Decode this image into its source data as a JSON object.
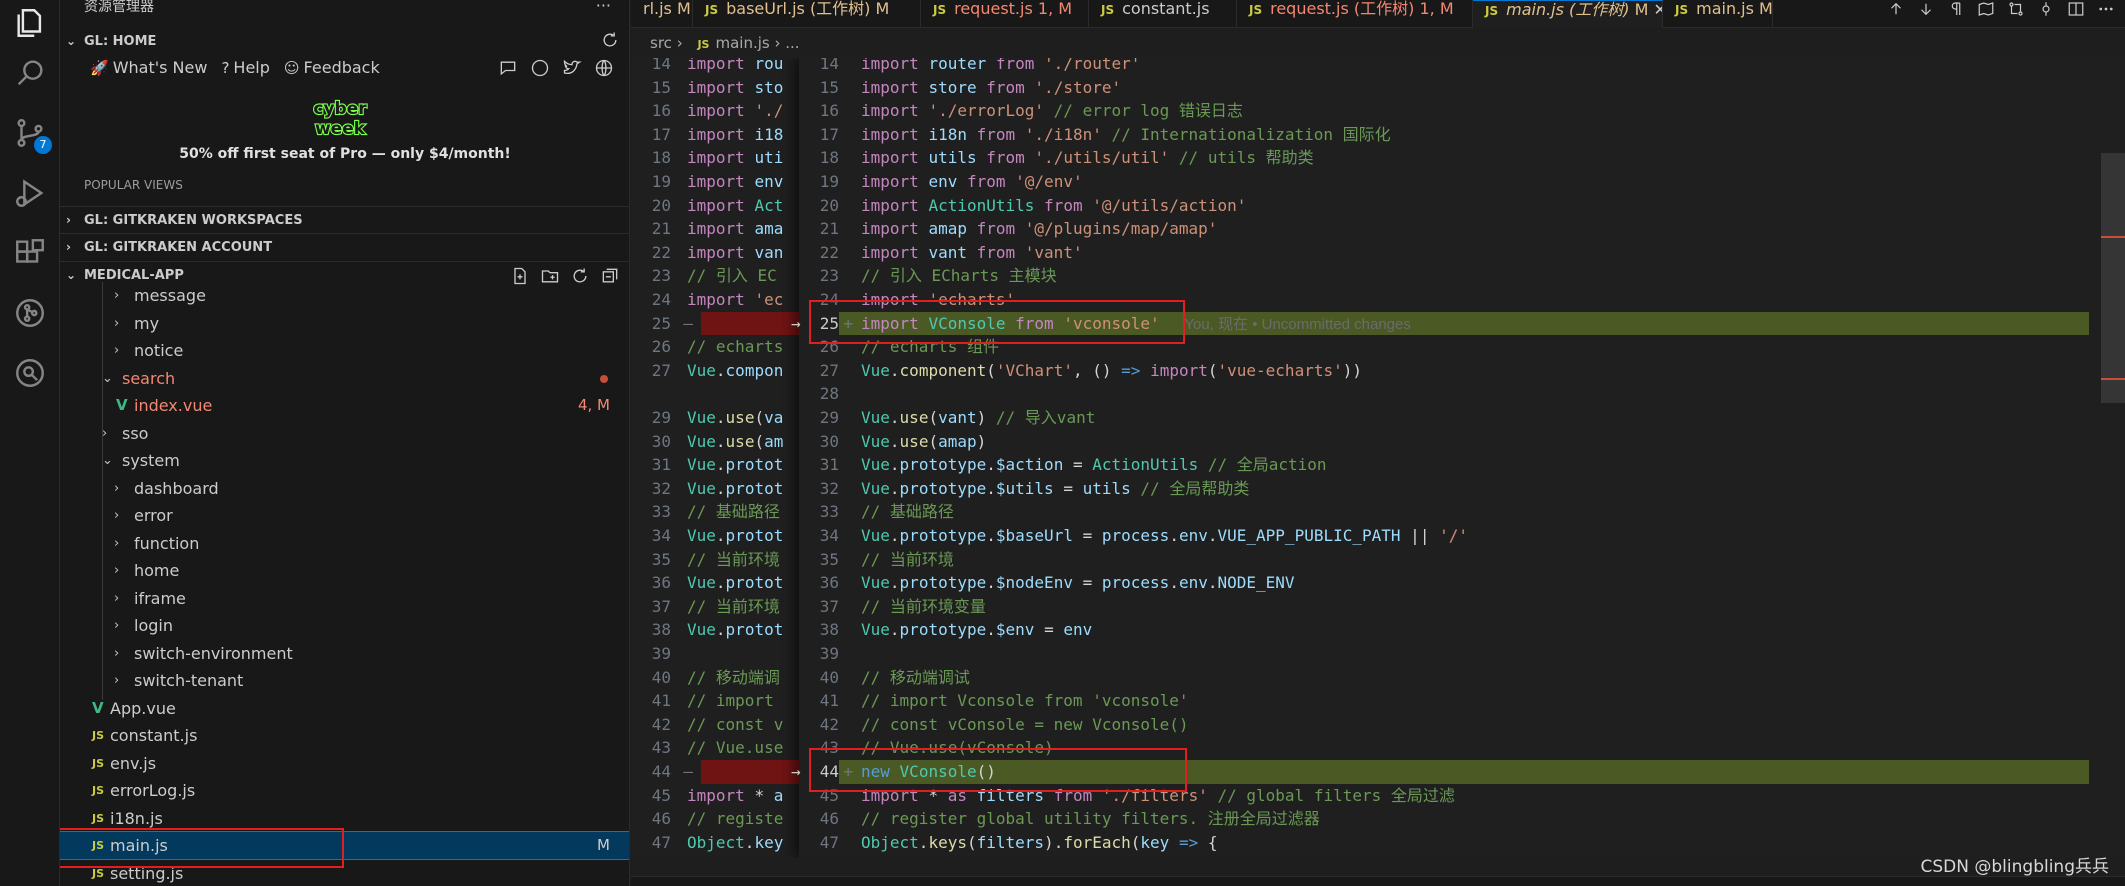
{
  "sidebar": {
    "title": "资源管理器",
    "gl_home": {
      "header": "GL: HOME",
      "links": [
        "What's New",
        "Help",
        "Feedback"
      ],
      "promo_logo_line1": "cyber",
      "promo_logo_line2": "week",
      "promo_text": "50% off first seat of Pro — only $4/month!",
      "popular": "POPULAR VIEWS"
    },
    "sections": {
      "workspaces": "GL: GITKRAKEN WORKSPACES",
      "account": "GL: GITKRAKEN ACCOUNT",
      "project": "MEDICAL-APP"
    },
    "tree": [
      {
        "label": "message",
        "type": "folder",
        "level": 2
      },
      {
        "label": "my",
        "type": "folder",
        "level": 2
      },
      {
        "label": "notice",
        "type": "folder",
        "level": 2
      },
      {
        "label": "search",
        "type": "folder-open",
        "level": 1,
        "status": "modified"
      },
      {
        "label": "index.vue",
        "type": "vue",
        "level": 2,
        "badge": "4, M"
      },
      {
        "label": "sso",
        "type": "folder",
        "level": 1
      },
      {
        "label": "system",
        "type": "folder-open",
        "level": 1
      },
      {
        "label": "dashboard",
        "type": "folder",
        "level": 2
      },
      {
        "label": "error",
        "type": "folder",
        "level": 2
      },
      {
        "label": "function",
        "type": "folder",
        "level": 2
      },
      {
        "label": "home",
        "type": "folder",
        "level": 2
      },
      {
        "label": "iframe",
        "type": "folder",
        "level": 2
      },
      {
        "label": "login",
        "type": "folder",
        "level": 2
      },
      {
        "label": "switch-environment",
        "type": "folder",
        "level": 2
      },
      {
        "label": "switch-tenant",
        "type": "folder",
        "level": 2
      },
      {
        "label": "App.vue",
        "type": "vue",
        "level": 0
      },
      {
        "label": "constant.js",
        "type": "js",
        "level": 0
      },
      {
        "label": "env.js",
        "type": "js",
        "level": 0
      },
      {
        "label": "errorLog.js",
        "type": "js",
        "level": 0
      },
      {
        "label": "i18n.js",
        "type": "js",
        "level": 0
      },
      {
        "label": "main.js",
        "type": "js",
        "level": 0,
        "badge": "M",
        "selected": true
      },
      {
        "label": "setting.js",
        "type": "js",
        "level": 0
      }
    ]
  },
  "badges": {
    "source_control": "7"
  },
  "tabs": [
    {
      "label": "rl.js",
      "suffix": "M",
      "color": "#e2c08d"
    },
    {
      "label": "baseUrl.js (工作树)",
      "suffix": "M",
      "color": "#e2c08d"
    },
    {
      "label": "request.js",
      "suffix": "1, M",
      "color": "#f48771"
    },
    {
      "label": "constant.js",
      "suffix": "",
      "color": "#cccccc"
    },
    {
      "label": "request.js (工作树)",
      "suffix": "1, M",
      "color": "#f48771"
    },
    {
      "label": "main.js (工作树)",
      "suffix": "M",
      "color": "#e2c08d",
      "active": true
    },
    {
      "label": "main.js",
      "suffix": "M",
      "color": "#e2c08d"
    }
  ],
  "breadcrumb": {
    "folder": "src",
    "sep": "›",
    "file": "main.js",
    "tail": "› ..."
  },
  "editor": {
    "left_lines": [
      [
        "14",
        "import rou"
      ],
      [
        "15",
        "import sto"
      ],
      [
        "16",
        "import './"
      ],
      [
        "17",
        "import i18"
      ],
      [
        "18",
        "import uti"
      ],
      [
        "19",
        "import env"
      ],
      [
        "20",
        "import Act"
      ],
      [
        "21",
        "import ama"
      ],
      [
        "22",
        "import van"
      ],
      [
        "23",
        "// 引入 EC"
      ],
      [
        "24",
        "import 'ec"
      ],
      [
        "25",
        ""
      ],
      [
        "26",
        "// echarts"
      ],
      [
        "27",
        "Vue.compon"
      ],
      [
        "",
        ""
      ],
      [
        "29",
        "Vue.use(va"
      ],
      [
        "30",
        "Vue.use(am"
      ],
      [
        "31",
        "Vue.protot"
      ],
      [
        "32",
        "Vue.protot"
      ],
      [
        "33",
        "// 基础路径"
      ],
      [
        "34",
        "Vue.protot"
      ],
      [
        "35",
        "// 当前环境"
      ],
      [
        "36",
        "Vue.protot"
      ],
      [
        "37",
        "// 当前环境"
      ],
      [
        "38",
        "Vue.protot"
      ],
      [
        "39",
        ""
      ],
      [
        "40",
        "// 移动端调"
      ],
      [
        "41",
        "// import "
      ],
      [
        "42",
        "// const v"
      ],
      [
        "43",
        "// Vue.use"
      ],
      [
        "44",
        ""
      ],
      [
        "45",
        "import * a"
      ],
      [
        "46",
        "// registe"
      ],
      [
        "47",
        "Object.key"
      ]
    ],
    "right_lines": [
      [
        "14",
        "import router from './router'"
      ],
      [
        "15",
        "import store from './store'"
      ],
      [
        "16",
        "import './errorLog' // error log 错误日志"
      ],
      [
        "17",
        "import i18n from './i18n' // Internationalization 国际化"
      ],
      [
        "18",
        "import utils from './utils/util' // utils 帮助类"
      ],
      [
        "19",
        "import env from '@/env'"
      ],
      [
        "20",
        "import ActionUtils from '@/utils/action'"
      ],
      [
        "21",
        "import amap from '@/plugins/map/amap'"
      ],
      [
        "22",
        "import vant from 'vant'"
      ],
      [
        "23",
        "// 引入 ECharts 主模块"
      ],
      [
        "24",
        "import 'echarts'"
      ],
      [
        "25",
        "import VConsole from 'vconsole'"
      ],
      [
        "26",
        "// echarts 组件"
      ],
      [
        "27",
        "Vue.component('VChart', () => import('vue-echarts'))"
      ],
      [
        "28",
        ""
      ],
      [
        "29",
        "Vue.use(vant) // 导入vant"
      ],
      [
        "30",
        "Vue.use(amap)"
      ],
      [
        "31",
        "Vue.prototype.$action = ActionUtils // 全局action"
      ],
      [
        "32",
        "Vue.prototype.$utils = utils // 全局帮助类"
      ],
      [
        "33",
        "// 基础路径"
      ],
      [
        "34",
        "Vue.prototype.$baseUrl = process.env.VUE_APP_PUBLIC_PATH || '/'"
      ],
      [
        "35",
        "// 当前环境"
      ],
      [
        "36",
        "Vue.prototype.$nodeEnv = process.env.NODE_ENV"
      ],
      [
        "37",
        "// 当前环境变量"
      ],
      [
        "38",
        "Vue.prototype.$env = env"
      ],
      [
        "39",
        ""
      ],
      [
        "40",
        "// 移动端调试"
      ],
      [
        "41",
        "// import Vconsole from 'vconsole'"
      ],
      [
        "42",
        "// const vConsole = new Vconsole()"
      ],
      [
        "43",
        "// Vue.use(vConsole)"
      ],
      [
        "44",
        "new VConsole()"
      ],
      [
        "45",
        "import * as filters from './filters' // global filters 全局过滤"
      ],
      [
        "46",
        "// register global utility filters. 注册全局过滤器"
      ],
      [
        "47",
        "Object.keys(filters).forEach(key => {"
      ]
    ],
    "blame": "You, 现在 • Uncommitted changes"
  },
  "watermark": "CSDN @blingbling兵兵"
}
